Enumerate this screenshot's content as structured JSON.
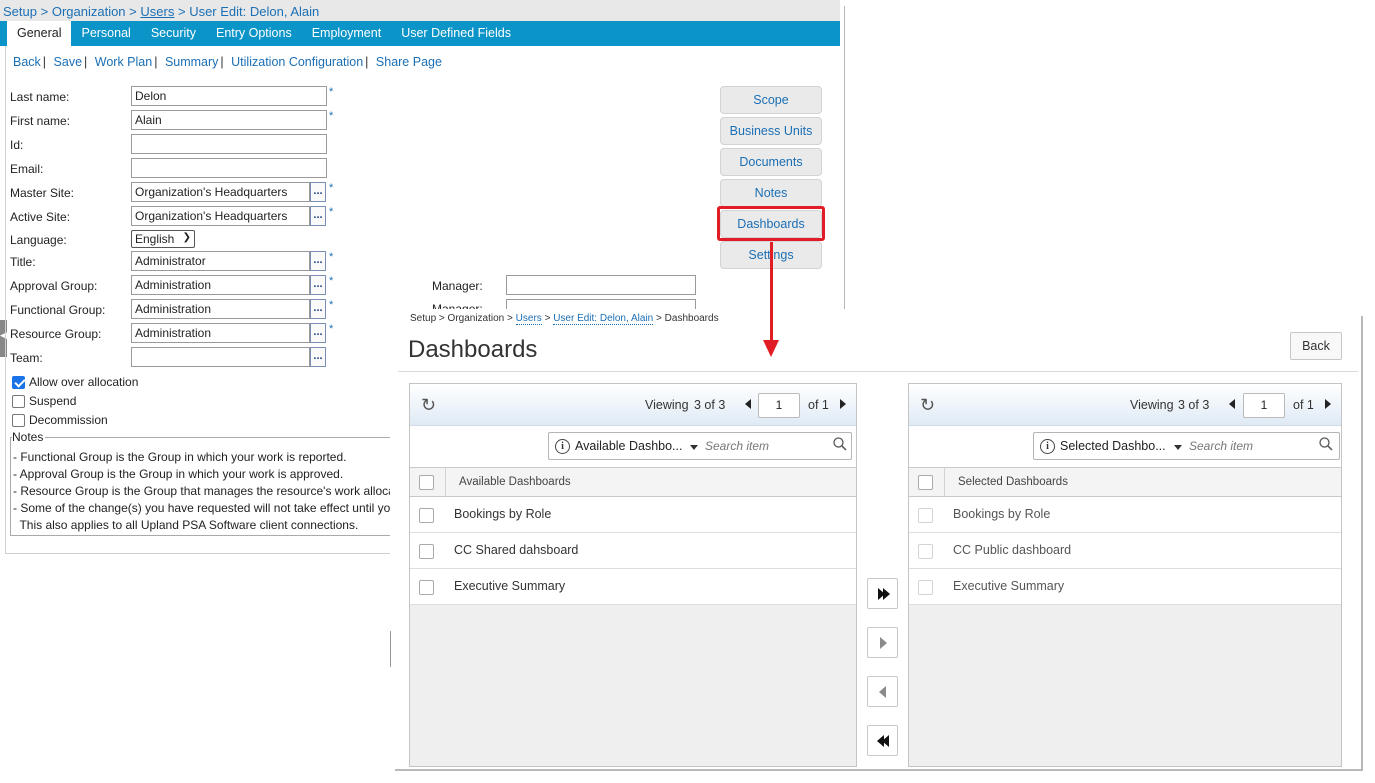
{
  "back_window": {
    "breadcrumb": {
      "setup": "Setup",
      "sep": ">",
      "organization": "Organization",
      "users": "Users",
      "current": "User Edit: Delon, Alain"
    },
    "tabs": [
      "General",
      "Personal",
      "Security",
      "Entry Options",
      "Employment",
      "User Defined Fields"
    ],
    "active_tab": "General",
    "actions": [
      "Back",
      "Save",
      "Work Plan",
      "Summary",
      "Utilization Configuration",
      "Share Page"
    ],
    "action_sep": "|",
    "required_mark": "*",
    "lookup_label": "...",
    "fields": {
      "last_name": {
        "label": "Last name:",
        "value": "Delon"
      },
      "first_name": {
        "label": "First name:",
        "value": "Alain"
      },
      "id": {
        "label": "Id:",
        "value": ""
      },
      "email": {
        "label": "Email:",
        "value": ""
      },
      "master_site": {
        "label": "Master Site:",
        "value": "Organization's Headquarters"
      },
      "active_site": {
        "label": "Active Site:",
        "value": "Organization's Headquarters"
      },
      "language": {
        "label": "Language:",
        "value": "English"
      },
      "title": {
        "label": "Title:",
        "value": "Administrator"
      },
      "approval_group": {
        "label": "Approval Group:",
        "value": "Administration"
      },
      "functional_group": {
        "label": "Functional Group:",
        "value": "Administration"
      },
      "resource_group": {
        "label": "Resource Group:",
        "value": "Administration"
      },
      "team": {
        "label": "Team:",
        "value": ""
      }
    },
    "checkboxes": {
      "allow_over_allocation": {
        "label": "Allow over allocation",
        "checked": true
      },
      "suspend": {
        "label": "Suspend",
        "checked": false
      },
      "decommission": {
        "label": "Decommission",
        "checked": false
      }
    },
    "notes": {
      "legend": "Notes",
      "lines": [
        "- Functional Group is the Group in which your work is reported.",
        "- Approval Group is the Group in which your work is approved.",
        "- Resource Group is the Group that manages the resource's work alloca",
        "- Some of the change(s) you have requested will not take effect until yo",
        "  This also applies to all Upland PSA Software client connections."
      ]
    },
    "manager_label": "Manager:",
    "side_buttons": [
      "Scope",
      "Business Units",
      "Documents",
      "Notes",
      "Dashboards",
      "Settings"
    ],
    "highlighted_button": "Dashboards",
    "highlight_color": "#e01c24"
  },
  "front_window": {
    "breadcrumb": {
      "setup": "Setup",
      "organization": "Organization",
      "users": "Users",
      "user_edit": "User Edit: Delon, Alain",
      "current": "Dashboards",
      "sep": ">"
    },
    "title": "Dashboards",
    "back_label": "Back",
    "left_panel": {
      "viewing_label": "Viewing",
      "viewing_count": "3 of 3",
      "page": "1",
      "of_pages": "of 1",
      "filter_label": "Available Dashbo...",
      "search_placeholder": "Search item",
      "column_header": "Available Dashboards",
      "rows": [
        "Bookings by Role",
        "CC Shared dahsboard",
        "Executive Summary"
      ]
    },
    "right_panel": {
      "viewing_label": "Viewing",
      "viewing_count": "3 of 3",
      "page": "1",
      "of_pages": "of 1",
      "filter_label": "Selected Dashbo...",
      "search_placeholder": "Search item",
      "column_header": "Selected Dashboards",
      "rows": [
        "Bookings by Role",
        "CC Public dashboard",
        "Executive Summary"
      ]
    },
    "move_buttons": [
      "move-all-right-button",
      "move-right-button",
      "move-left-button",
      "move-all-left-button"
    ],
    "icons": [
      "refresh-icon",
      "info-icon",
      "dropdown-caret-icon",
      "search-icon",
      "chevron-left-icon",
      "chevron-right-icon"
    ]
  },
  "colors": {
    "tab_bar": "#0a94c8",
    "link": "#1b6fb5",
    "checkbox_checked": "#1a73e8",
    "annotation_red": "#e01c24"
  }
}
